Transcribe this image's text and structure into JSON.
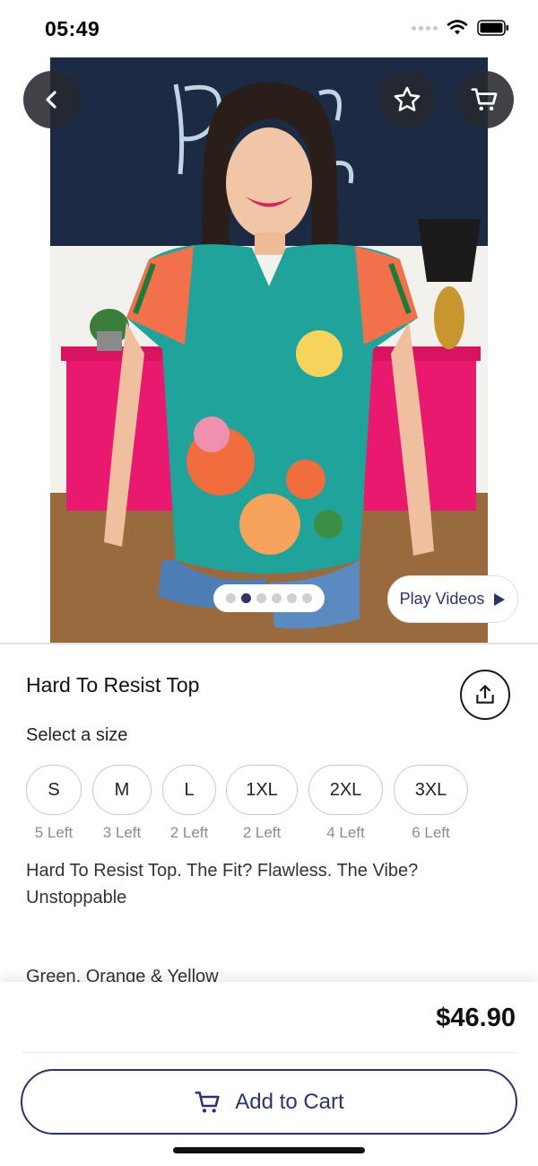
{
  "status_bar": {
    "time": "05:49"
  },
  "photo": {
    "image_description": "",
    "page_indicator": {
      "count": 6,
      "active_index": 1
    }
  },
  "toolbar": {
    "play_videos_label": "Play Videos"
  },
  "product": {
    "title": "Hard To Resist Top",
    "select_size_label": "Select a size",
    "sizes": [
      {
        "label": "S",
        "stock": "5 Left"
      },
      {
        "label": "M",
        "stock": "3 Left"
      },
      {
        "label": "L",
        "stock": "2 Left"
      },
      {
        "label": "1XL",
        "stock": "2 Left"
      },
      {
        "label": "2XL",
        "stock": "4 Left"
      },
      {
        "label": "3XL",
        "stock": "6 Left"
      }
    ],
    "description": "Hard To Resist Top. The Fit? Flawless. The Vibe? Unstoppable",
    "color": "Green, Orange & Yellow",
    "price": "$46.90"
  },
  "actions": {
    "add_to_cart_label": "Add to Cart"
  },
  "icons": {
    "back": "chevron-left-icon",
    "favorite": "star-outline-icon",
    "cart": "cart-icon",
    "share": "share-icon",
    "play": "play-icon"
  },
  "colors": {
    "accent": "#2a3468",
    "button_dark": "#26282e",
    "muted_text": "#8c8c90",
    "chip_border": "#c9c9cc"
  }
}
